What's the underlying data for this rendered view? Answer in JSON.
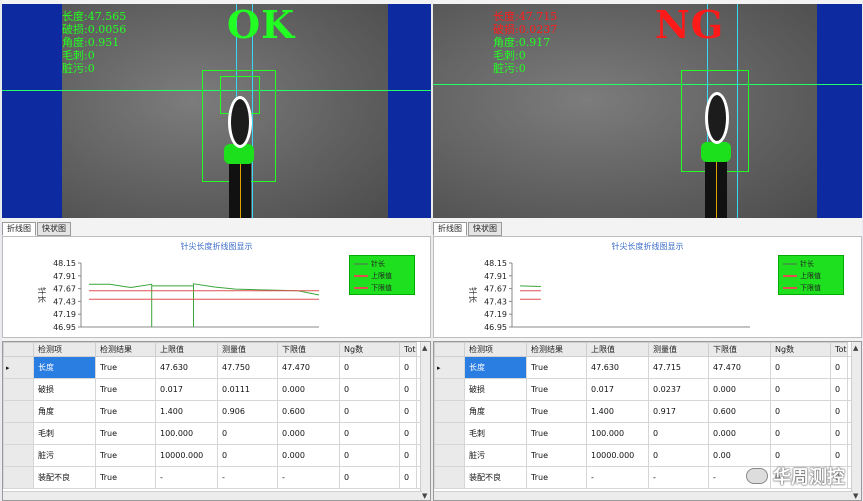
{
  "left": {
    "overlay": {
      "length": "长度:47.565",
      "damage": "破损:0.0056",
      "angle": "角度:0.951",
      "burr": "毛刺:0",
      "dirt": "脏污:0"
    },
    "verdict": "OK",
    "tabs": [
      "折线图",
      "快状图"
    ],
    "chart_title": "针尖长度折线图显示",
    "legend": [
      "针长",
      "上限值",
      "下限值"
    ],
    "ylabel": "针长",
    "yticks": [
      "48.15",
      "47.91",
      "47.67",
      "47.43",
      "47.19",
      "46.95"
    ],
    "table": {
      "headers": [
        "",
        "检测项",
        "检测结果",
        "上限值",
        "测量值",
        "下限值",
        "Ng数",
        "Tot"
      ],
      "rows": [
        {
          "marker": "▸",
          "cells": [
            "长度",
            "True",
            "47.630",
            "47.750",
            "47.470",
            "0",
            "0"
          ]
        },
        {
          "marker": "",
          "cells": [
            "破损",
            "True",
            "0.017",
            "0.0111",
            "0.000",
            "0",
            "0"
          ]
        },
        {
          "marker": "",
          "cells": [
            "角度",
            "True",
            "1.400",
            "0.906",
            "0.600",
            "0",
            "0"
          ]
        },
        {
          "marker": "",
          "cells": [
            "毛刺",
            "True",
            "100.000",
            "0",
            "0.000",
            "0",
            "0"
          ]
        },
        {
          "marker": "",
          "cells": [
            "脏污",
            "True",
            "10000.000",
            "0",
            "0.000",
            "0",
            "0"
          ]
        },
        {
          "marker": "",
          "cells": [
            "装配不良",
            "True",
            "-",
            "-",
            "-",
            "0",
            "0"
          ]
        }
      ]
    }
  },
  "right": {
    "overlay": {
      "length": "长度:47.715",
      "damage": "破损:0.0237",
      "angle": "角度:0.917",
      "burr": "毛刺:0",
      "dirt": "脏污:0"
    },
    "verdict": "NG",
    "tabs": [
      "折线图",
      "快状图"
    ],
    "chart_title": "针尖长度折线图显示",
    "legend": [
      "针长",
      "上限值",
      "下限值"
    ],
    "ylabel": "针长",
    "yticks": [
      "48.15",
      "47.91",
      "47.67",
      "47.43",
      "47.19",
      "46.95"
    ],
    "table": {
      "headers": [
        "",
        "检测项",
        "检测结果",
        "上限值",
        "测量值",
        "下限值",
        "Ng数",
        "Tot"
      ],
      "rows": [
        {
          "marker": "▸",
          "cells": [
            "长度",
            "True",
            "47.630",
            "47.715",
            "47.470",
            "0",
            "0"
          ]
        },
        {
          "marker": "",
          "cells": [
            "破损",
            "True",
            "0.017",
            "0.0237",
            "0.000",
            "0",
            "0"
          ]
        },
        {
          "marker": "",
          "cells": [
            "角度",
            "True",
            "1.400",
            "0.917",
            "0.600",
            "0",
            "0"
          ]
        },
        {
          "marker": "",
          "cells": [
            "毛刺",
            "True",
            "100.000",
            "0",
            "0.000",
            "0",
            "0"
          ]
        },
        {
          "marker": "",
          "cells": [
            "脏污",
            "True",
            "10000.000",
            "0",
            "0.00",
            "0",
            "0"
          ]
        },
        {
          "marker": "",
          "cells": [
            "装配不良",
            "True",
            "-",
            "-",
            "-",
            "0",
            "0"
          ]
        }
      ]
    }
  },
  "chart_data": [
    {
      "type": "line",
      "ylim": [
        46.95,
        48.15
      ],
      "yticks": [
        48.15,
        47.91,
        47.67,
        47.43,
        47.19,
        46.95
      ],
      "ylabel": "针长",
      "series": [
        {
          "name": "针长",
          "color": "#3aa53a",
          "x": [
            0,
            1,
            2,
            3,
            3,
            3,
            4,
            5,
            5,
            5,
            6,
            7,
            8,
            9,
            10,
            11
          ],
          "values": [
            47.75,
            47.75,
            47.69,
            47.75,
            46.95,
            47.72,
            47.72,
            47.72,
            46.95,
            47.76,
            47.7,
            47.66,
            47.65,
            47.64,
            47.63,
            47.55
          ]
        },
        {
          "name": "上限值",
          "color": "#e05050",
          "x": [
            0,
            11
          ],
          "values": [
            47.63,
            47.63
          ]
        },
        {
          "name": "下限值",
          "color": "#e05050",
          "x": [
            0,
            11
          ],
          "values": [
            47.47,
            47.47
          ]
        }
      ],
      "legend_position": "right"
    },
    {
      "type": "line",
      "ylim": [
        46.95,
        48.15
      ],
      "yticks": [
        48.15,
        47.91,
        47.67,
        47.43,
        47.19,
        46.95
      ],
      "ylabel": "针长",
      "series": [
        {
          "name": "针长",
          "color": "#3aa53a",
          "x": [
            0,
            1
          ],
          "values": [
            47.72,
            47.71
          ]
        },
        {
          "name": "上限值",
          "color": "#e05050",
          "x": [
            0,
            1
          ],
          "values": [
            47.63,
            47.63
          ]
        },
        {
          "name": "下限值",
          "color": "#e05050",
          "x": [
            0,
            1
          ],
          "values": [
            47.47,
            47.47
          ]
        }
      ],
      "legend_position": "right"
    }
  ],
  "watermark": "华周测控",
  "colors": {
    "ok": "#22ff22",
    "ng": "#ff1a1a",
    "selected": "#2a7de1"
  }
}
